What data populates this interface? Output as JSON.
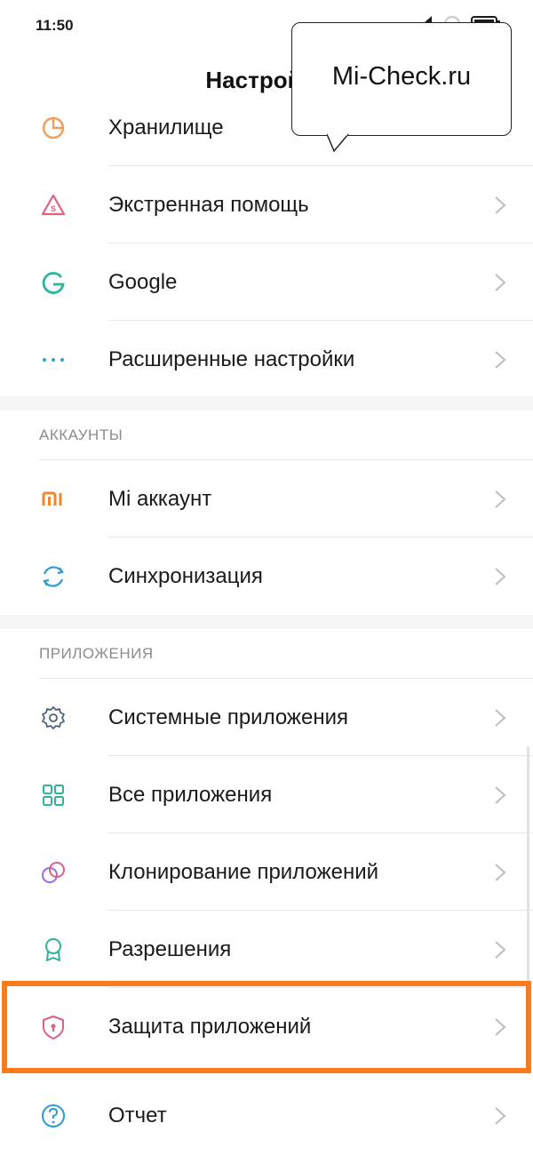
{
  "status_bar": {
    "time": "11:50"
  },
  "header": {
    "title": "Настройки"
  },
  "rows_top": [
    {
      "label": "Хранилище",
      "icon": "storage-pie-icon"
    },
    {
      "label": "Экстренная помощь",
      "icon": "sos-triangle-icon"
    },
    {
      "label": "Google",
      "icon": "google-g-icon"
    },
    {
      "label": "Расширенные настройки",
      "icon": "more-dots-icon"
    }
  ],
  "accounts": {
    "title": "АККАУНТЫ",
    "items": [
      {
        "label": "Mi аккаунт",
        "icon": "mi-logo-icon"
      },
      {
        "label": "Синхронизация",
        "icon": "sync-icon"
      }
    ]
  },
  "apps": {
    "title": "ПРИЛОЖЕНИЯ",
    "items": [
      {
        "label": "Системные приложения",
        "icon": "gear-icon"
      },
      {
        "label": "Все приложения",
        "icon": "grid-icon"
      },
      {
        "label": "Клонирование приложений",
        "icon": "clone-icon"
      },
      {
        "label": "Разрешения",
        "icon": "badge-icon"
      },
      {
        "label": "Защита приложений",
        "icon": "shield-lock-icon"
      },
      {
        "label": "Отчет",
        "icon": "question-icon"
      }
    ]
  },
  "callout": {
    "text": "Mi-Check.ru"
  },
  "colors": {
    "highlight": "#ff7a1a",
    "storage": "#f39c5a",
    "sos": "#e0607e",
    "google": "#2bb59a",
    "dots": "#2aa8c4",
    "mi": "#f0872b",
    "sync": "#2d9bd6",
    "gear": "#4a6178",
    "grid": "#2bb59a",
    "clone": "#9b6be0",
    "badge": "#2bb59a",
    "shield": "#e0607e",
    "question": "#2d9bd6"
  }
}
